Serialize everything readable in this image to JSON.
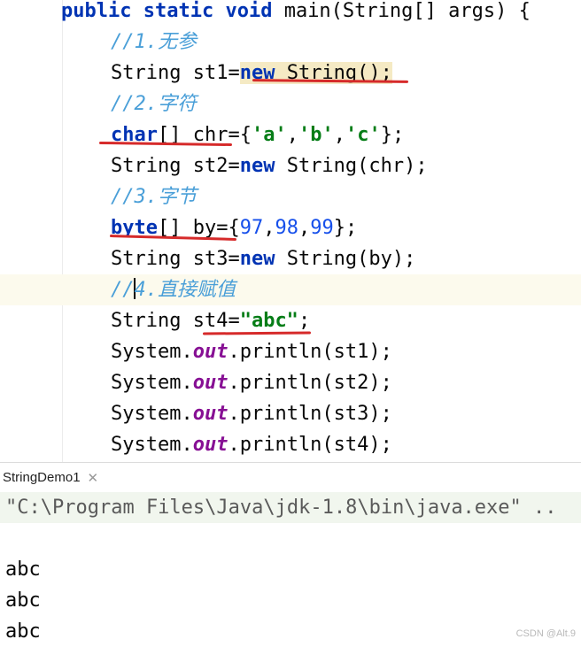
{
  "editor": {
    "code": {
      "main_kw1": "public",
      "main_kw2": "static",
      "main_kw3": "void",
      "main_rest": " main(String[] args) {",
      "c1": "//1.无参",
      "l2_a": "String st1=",
      "l2_kw": "new",
      "l2_b": " String()",
      "l2_c": ";",
      "c2": "//2.字符",
      "l4_kw": "char",
      "l4_a": "[] chr={",
      "l4_s1": "'a'",
      "l4_comma1": ",",
      "l4_s2": "'b'",
      "l4_comma2": ",",
      "l4_s3": "'c'",
      "l4_b": "};",
      "l5_a": "String st2=",
      "l5_kw": "new",
      "l5_b": " String(chr);",
      "c3": "//3.字节",
      "l7_kw": "byte",
      "l7_a": "[] by={",
      "l7_n1": "97",
      "l7_comma1": ",",
      "l7_n2": "98",
      "l7_comma2": ",",
      "l7_n3": "99",
      "l7_b": "};",
      "l8_a": "String st3=",
      "l8_kw": "new",
      "l8_b": " String(by);",
      "c4_a": "//",
      "c4_b": "4.直接赋值",
      "l10_a": "String st4=",
      "l10_s": "\"abc\"",
      "l10_b": ";",
      "sys": "System.",
      "out": "out",
      "p1": ".println(st1);",
      "p2": ".println(st2);",
      "p3": ".println(st3);",
      "p4": ".println(st4);"
    }
  },
  "run_panel": {
    "tab_label": "StringDemo1",
    "command": "\"C:\\Program Files\\Java\\jdk-1.8\\bin\\java.exe\" ..",
    "output": [
      "abc",
      "abc",
      "abc"
    ]
  },
  "watermark": "CSDN @Alt.9",
  "colors": {
    "keyword": "#0033b3",
    "string": "#067d17",
    "number": "#1750eb",
    "field": "#871094",
    "annotation_underline": "#d62a2a"
  }
}
